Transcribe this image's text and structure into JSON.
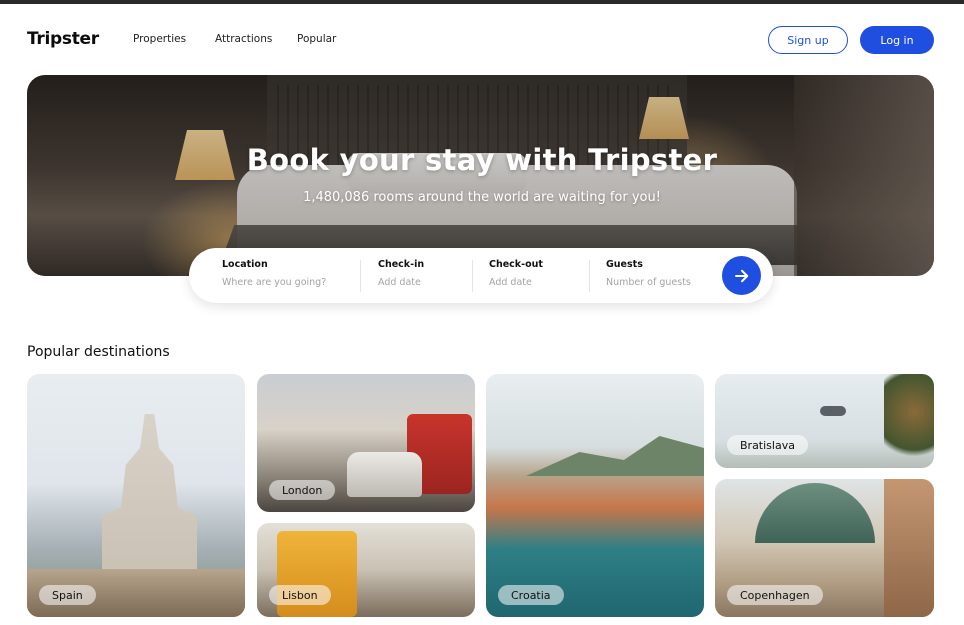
{
  "app": {
    "logo": "Tripster"
  },
  "nav": {
    "items": [
      {
        "label": "Properties"
      },
      {
        "label": "Attractions"
      },
      {
        "label": "Popular"
      }
    ],
    "signup_label": "Sign up",
    "login_label": "Log in"
  },
  "hero": {
    "title": "Book your stay with Tripster",
    "subtitle": "1,480,086 rooms around the world are waiting for you!"
  },
  "search": {
    "location": {
      "label": "Location",
      "placeholder": "Where are you going?"
    },
    "checkin": {
      "label": "Check-in",
      "placeholder": "Add date"
    },
    "checkout": {
      "label": "Check-out",
      "placeholder": "Add date"
    },
    "guests": {
      "label": "Guests",
      "placeholder": "Number of guests"
    },
    "submit_icon": "arrow-right-icon"
  },
  "destinations": {
    "title": "Popular destinations",
    "items": [
      {
        "label": "Spain"
      },
      {
        "label": "London"
      },
      {
        "label": "Lisbon"
      },
      {
        "label": "Croatia"
      },
      {
        "label": "Bratislava"
      },
      {
        "label": "Copenhagen"
      }
    ]
  },
  "colors": {
    "accent": "#1f4fe0",
    "text": "#111111"
  }
}
